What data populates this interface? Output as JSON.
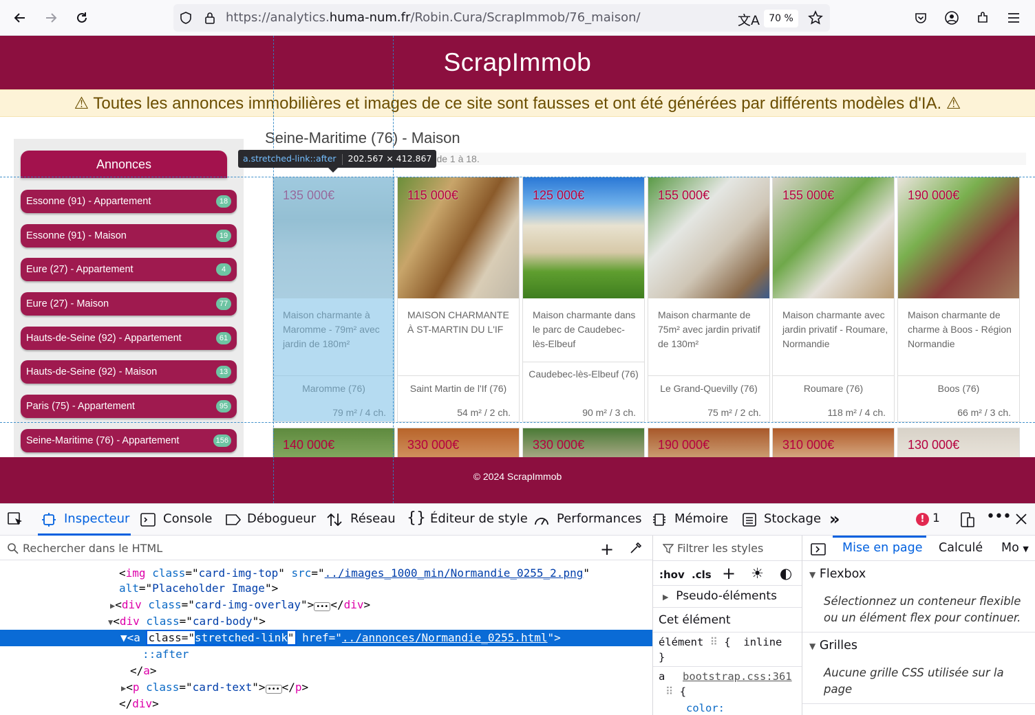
{
  "browser": {
    "url_prefix": "https://analytics.",
    "url_domain": "huma-num.fr",
    "url_path": "/Robin.Cura/ScrapImmob/76_maison/",
    "zoom": "70 %"
  },
  "site": {
    "brand": "ScrapImmob",
    "warning": "⚠ Toutes les annonces immobilières et images de ce site sont fausses et ont été générées par différents modèles d'IA. ⚠",
    "footer": "© 2024 ScrapImmob"
  },
  "sidebar": {
    "title": "Annonces",
    "items": [
      {
        "label": "Essonne (91) - Appartement",
        "count": "18"
      },
      {
        "label": "Essonne (91) - Maison",
        "count": "19"
      },
      {
        "label": "Eure (27) - Appartement",
        "count": "4"
      },
      {
        "label": "Eure (27) - Maison",
        "count": "77"
      },
      {
        "label": "Hauts-de-Seine (92) - Appartement",
        "count": "61"
      },
      {
        "label": "Hauts-de-Seine (92) - Maison",
        "count": "13"
      },
      {
        "label": "Paris (75) - Appartement",
        "count": "95"
      },
      {
        "label": "Seine-Maritime (76) - Appartement",
        "count": "156"
      }
    ]
  },
  "main": {
    "title": "Seine-Maritime (76) - Maison",
    "pagination": "ge de 1 à 18.",
    "tooltip_selector": "a.stretched-link::after",
    "tooltip_size": "202.567 × 412.867",
    "cards": [
      {
        "price": "135 000€",
        "desc": "Maison charmante à Maromme - 79m² avec jardin de 180m²",
        "loc": "Maromme (76)",
        "surf": "79 m² / 4 ch."
      },
      {
        "price": "115 000€",
        "desc": "MAISON CHARMANTE À ST-MARTIN DU L'IF",
        "loc": "Saint Martin de l'If (76)",
        "surf": "54 m² / 2 ch."
      },
      {
        "price": "125 000€",
        "desc": "Maison charmante dans le parc de Caudebec-lès-Elbeuf",
        "loc": "Caudebec-lès-Elbeuf (76)",
        "surf": "90 m² / 3 ch."
      },
      {
        "price": "155 000€",
        "desc": "Maison charmante de 75m² avec jardin privatif de 130m²",
        "loc": "Le Grand-Quevilly (76)",
        "surf": "75 m² / 2 ch."
      },
      {
        "price": "155 000€",
        "desc": "Maison charmante avec jardin privatif - Roumare, Normandie",
        "loc": "Roumare (76)",
        "surf": "118 m² / 4 ch."
      },
      {
        "price": "190 000€",
        "desc": "Maison charmante de charme à Boos - Région Normandie",
        "loc": "Boos (76)",
        "surf": "66 m² / 3 ch."
      }
    ],
    "row2_prices": [
      "140 000€",
      "330 000€",
      "330 000€",
      "190 000€",
      "310 000€",
      "130 000€"
    ]
  },
  "devtools": {
    "tabs": [
      "Inspecteur",
      "Console",
      "Débogueur",
      "Réseau",
      "Éditeur de style",
      "Performances",
      "Mémoire",
      "Stockage"
    ],
    "error_count": "1",
    "search_placeholder": "Rechercher dans le HTML",
    "filter_placeholder": "Filtrer les styles",
    "hov": ":hov",
    "cls": ".cls",
    "pseudo": "Pseudo-éléments",
    "this_element": "Cet élément",
    "rule1_sel": "élément",
    "rule1_open": "{",
    "rule1_val": "inline",
    "rule1_close": "}",
    "rule2_sel": "a",
    "rule2_src": "bootstrap.css:361",
    "rule2_open": "{",
    "rule2_prop": "color:",
    "layout_tabs": [
      "Mise en page",
      "Calculé",
      "Mo"
    ],
    "flexbox": "Flexbox",
    "flex_msg": "Sélectionnez un conteneur flexible ou un élément flex pour continuer.",
    "grids": "Grilles",
    "grid_msg": "Aucune grille CSS utilisée sur la page",
    "html_lines": {
      "l1_tag": "img",
      "l1_attr1": "class",
      "l1_val1": "card-img-top",
      "l1_attr2": "src",
      "l1_val2": "../images_1000_min/Normandie_0255_2.png",
      "l2_attr": "alt",
      "l2_val": "Placeholder Image",
      "l3_tag": "div",
      "l3_attr": "class",
      "l3_val": "card-img-overlay",
      "l4_tag": "div",
      "l4_attr": "class",
      "l4_val": "card-body",
      "l5_tag": "a",
      "l5_attr1": "class",
      "l5_val1": "stretched-link",
      "l5_attr2": "href",
      "l5_val2": "../annonces/Normandie_0255.html",
      "l6_pseudo": "::after",
      "l7_close": "a",
      "l8_tag": "p",
      "l8_attr": "class",
      "l8_val": "card-text",
      "l9_close": "div"
    }
  }
}
